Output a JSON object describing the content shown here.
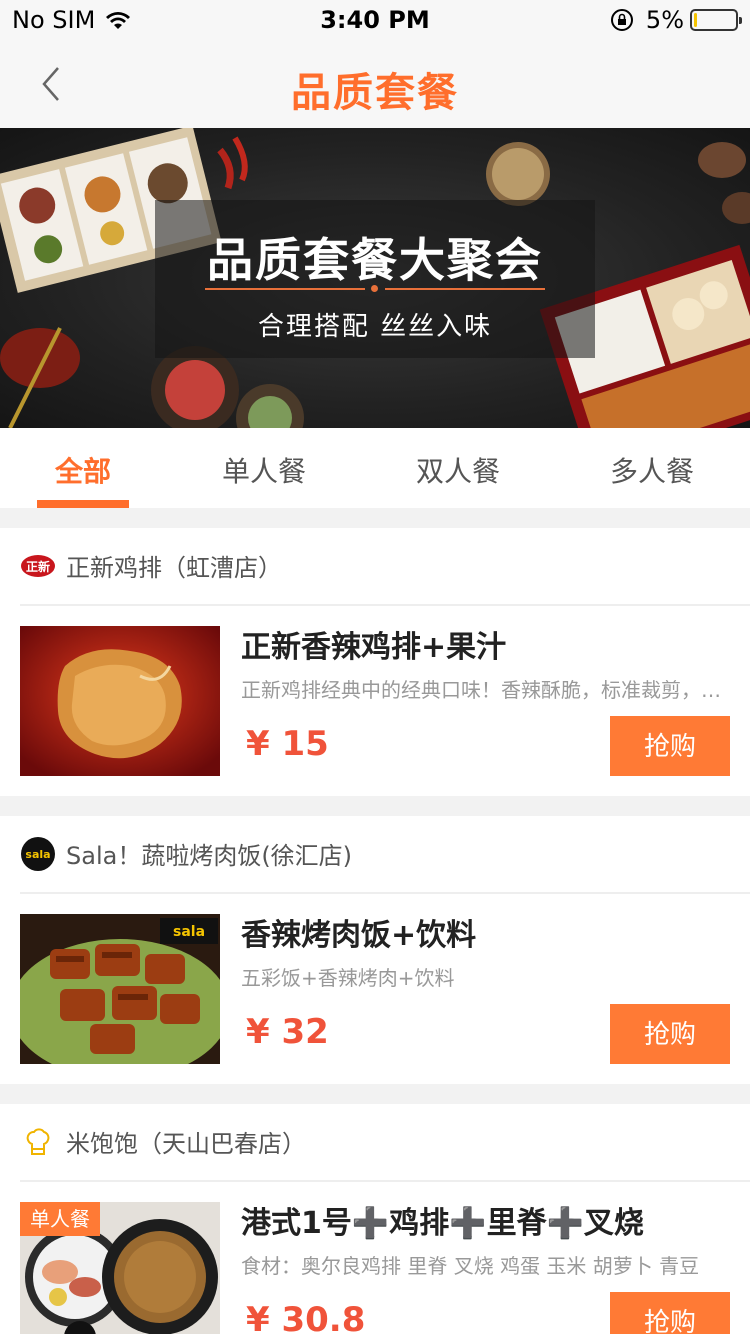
{
  "status_bar": {
    "carrier": "No SIM",
    "time": "3:40 PM",
    "battery_percent": "5%",
    "battery_level": 0.05
  },
  "nav": {
    "title": "品质套餐"
  },
  "banner": {
    "title": "品质套餐大聚会",
    "subtitle": "合理搭配  丝丝入味"
  },
  "tabs": [
    {
      "label": "全部",
      "active": true
    },
    {
      "label": "单人餐",
      "active": false
    },
    {
      "label": "双人餐",
      "active": false
    },
    {
      "label": "多人餐",
      "active": false
    }
  ],
  "deals": [
    {
      "store": "正新鸡排（虹漕店）",
      "store_logo_text": "正新",
      "title": "正新香辣鸡排+果汁",
      "desc": "正新鸡排经典中的经典口味！香辣酥脆，标准裁剪，超大鸡排",
      "price": "¥ 15",
      "buy_label": "抢购"
    },
    {
      "store": "Sala！蔬啦烤肉饭(徐汇店)",
      "store_logo_text": "sala",
      "title": "香辣烤肉饭+饮料",
      "desc": "五彩饭+香辣烤肉+饮料",
      "price": "¥ 32",
      "buy_label": "抢购"
    },
    {
      "store": "米饱饱（天山巴春店）",
      "title": "港式1号➕鸡排➕里脊➕叉烧",
      "desc": "食材：奥尔良鸡排 里脊 叉烧 鸡蛋 玉米 胡萝卜 青豆",
      "price": "¥ 30.8",
      "buy_label": "抢购",
      "tag": "单人餐"
    }
  ],
  "colors": {
    "accent": "#ff6e2c",
    "price": "#f0533a",
    "button": "#ff7a35"
  }
}
